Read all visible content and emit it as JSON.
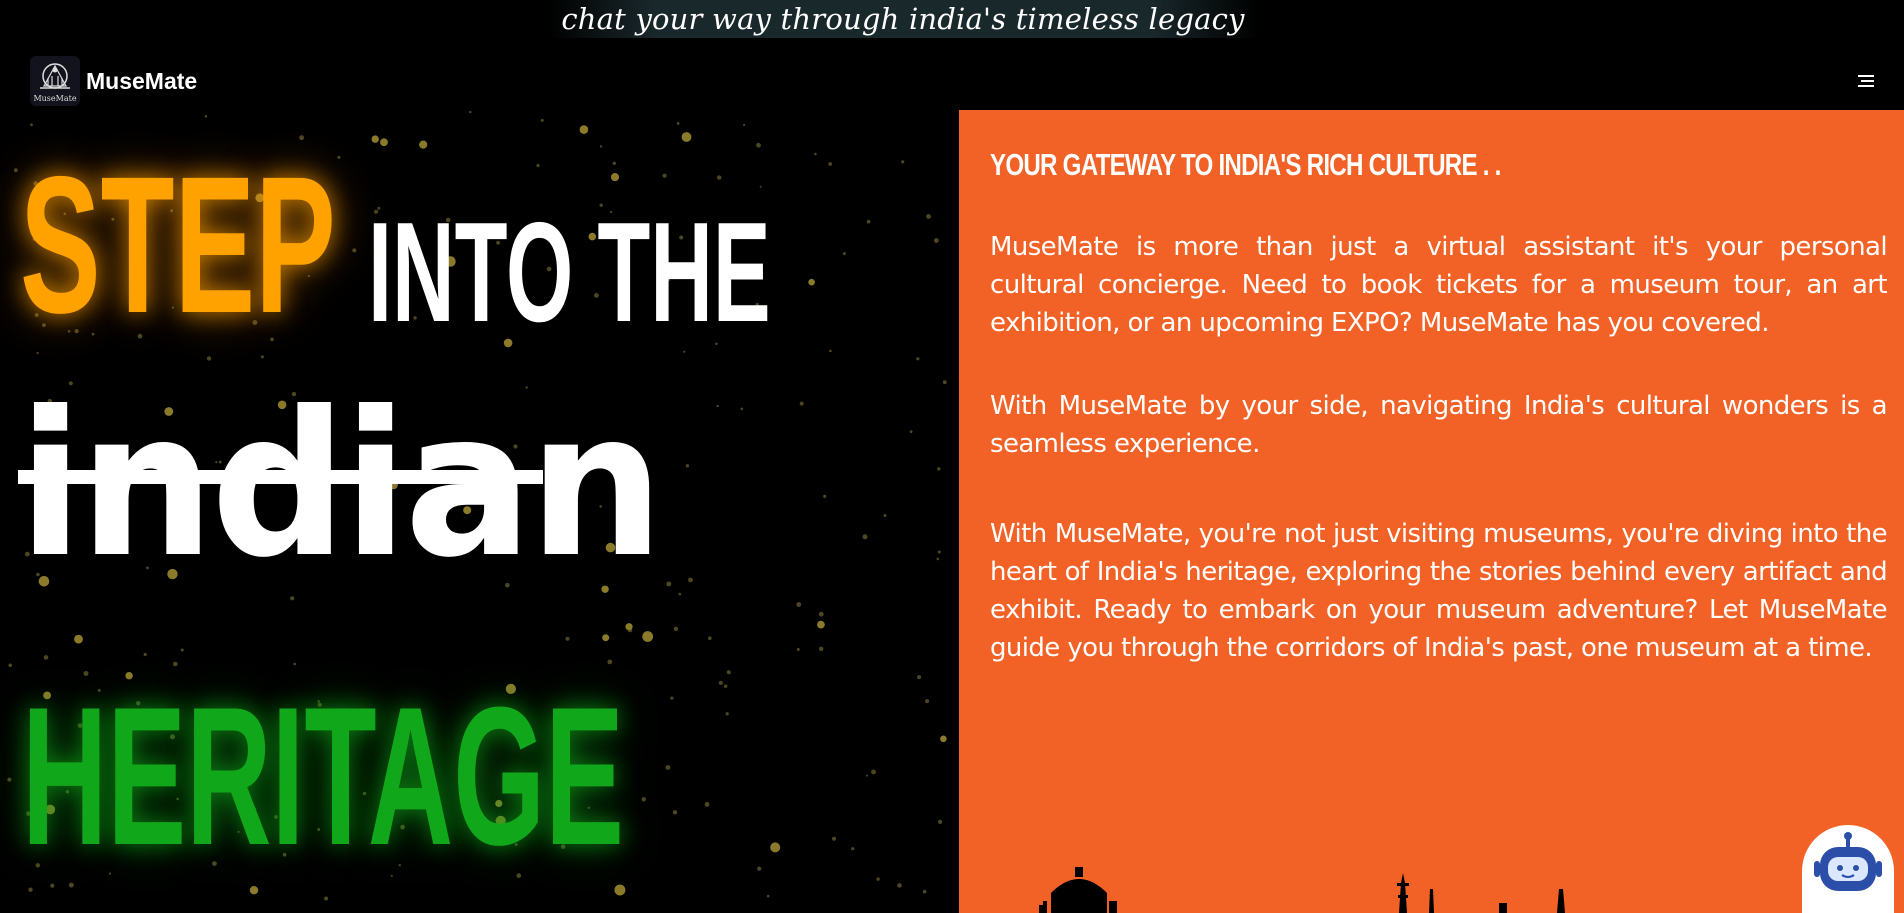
{
  "banner": {
    "tagline": "chat your way through india's timeless legacy"
  },
  "navbar": {
    "logo_text": "MuseMate",
    "brand_name": "MuseMate",
    "menu_icon": "menu-icon"
  },
  "hero": {
    "word_1": "STEP",
    "word_2": "INTO THE",
    "word_3": "indian",
    "word_4": "HERITAGE",
    "colors": {
      "step": "#ffa200",
      "heritage": "#10a81a",
      "background": "#000000"
    }
  },
  "info": {
    "heading": "YOUR GATEWAY TO INDIA'S RICH CULTURE . .",
    "paragraphs": [
      "MuseMate is more than just a virtual assistant it's your personal cultural concierge. Need to book tickets for a museum tour, an art exhibition, or an upcoming EXPO? MuseMate has you covered.",
      "With MuseMate by your side, navigating India's cultural wonders is a seamless experience.",
      "With MuseMate, you're not just visiting museums, you're diving into the heart of India's heritage, exploring the stories behind every artifact and exhibit. Ready to embark on your museum adventure? Let MuseMate guide you through the corridors of India's past, one museum at a time."
    ],
    "colors": {
      "panel": "#f26125"
    }
  },
  "chatbot": {
    "icon": "chatbot-icon"
  }
}
